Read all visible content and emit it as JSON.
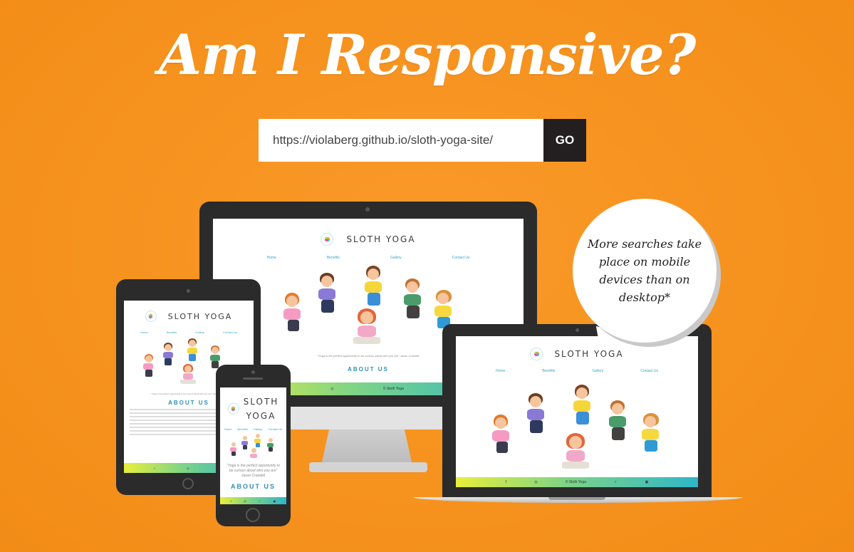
{
  "page": {
    "title": "Am I Responsive?"
  },
  "url_form": {
    "value": "https://violaberg.github.io/sloth-yoga-site/",
    "go_label": "GO"
  },
  "bubble": {
    "text": "More searches take place on mobile devices than on desktop*"
  },
  "site": {
    "title": "SLOTH YOGA",
    "title_line1": "SLOTH",
    "title_line2": "YOGA",
    "nav": [
      "Home",
      "Benefits",
      "Gallery",
      "Contact Us"
    ],
    "quote_desktop": "\"Yoga is the perfect opportunity to be curious about who you are\" Jason Crandell",
    "quote_phone": "\"Yoga is the perfect opportunity to be curious about who you are\" Jason Crandell",
    "about": "ABOUT US",
    "footer_credit": "© Sloth Yoga"
  },
  "colors": {
    "background": "#f6921e",
    "go_button": "#231f20",
    "device": "#2b2b2b",
    "accent": "#3aa3c9"
  }
}
